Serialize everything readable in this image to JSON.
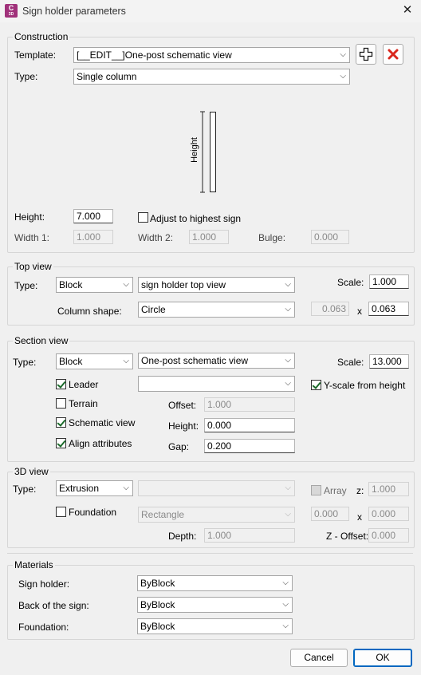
{
  "window": {
    "title": "Sign holder parameters",
    "app_icon_letter": "C",
    "app_icon_sub": "3D"
  },
  "construction": {
    "legend": "Construction",
    "template_label": "Template:",
    "template_value": "[__EDIT__]One-post schematic view",
    "type_label": "Type:",
    "type_value": "Single column",
    "preview_height_label": "Height",
    "height_label": "Height:",
    "height_value": "7.000",
    "adjust_label": "Adjust to highest sign",
    "adjust_checked": false,
    "width1_label": "Width 1:",
    "width1_value": "1.000",
    "width2_label": "Width 2:",
    "width2_value": "1.000",
    "bulge_label": "Bulge:",
    "bulge_value": "0.000"
  },
  "top_view": {
    "legend": "Top view",
    "type_label": "Type:",
    "type_value": "Block",
    "block_value": "sign holder top view",
    "scale_label": "Scale:",
    "scale_value": "1.000",
    "column_shape_label": "Column shape:",
    "column_shape_value": "Circle",
    "dim_x_value": "0.063",
    "x_label": "x",
    "dim_y_value": "0.063"
  },
  "section_view": {
    "legend": "Section view",
    "type_label": "Type:",
    "type_value": "Block",
    "block_value": "One-post schematic view",
    "scale_label": "Scale:",
    "scale_value": "13.000",
    "leader_label": "Leader",
    "leader_checked": true,
    "leader_select_value": "",
    "yscale_label": "Y-scale from height",
    "yscale_checked": true,
    "terrain_label": "Terrain",
    "terrain_checked": false,
    "offset_label": "Offset:",
    "offset_value": "1.000",
    "schematic_label": "Schematic view",
    "schematic_checked": true,
    "height_label": "Height:",
    "height_value": "0.000",
    "align_label": "Align attributes",
    "align_checked": true,
    "gap_label": "Gap:",
    "gap_value": "0.200"
  },
  "view3d": {
    "legend": "3D view",
    "type_label": "Type:",
    "type_value": "Extrusion",
    "second_select_value": "",
    "array_label": "Array",
    "z_label": "z:",
    "z_value": "1.000",
    "foundation_label": "Foundation",
    "foundation_checked": false,
    "foundation_shape_value": "Rectangle",
    "fx_value": "0.000",
    "x_label": "x",
    "fy_value": "0.000",
    "depth_label": "Depth:",
    "depth_value": "1.000",
    "zoffset_label": "Z - Offset:",
    "zoffset_value": "0.000"
  },
  "materials": {
    "legend": "Materials",
    "sign_holder_label": "Sign holder:",
    "sign_holder_value": "ByBlock",
    "back_label": "Back of the sign:",
    "back_value": "ByBlock",
    "foundation_label": "Foundation:",
    "foundation_value": "ByBlock"
  },
  "buttons": {
    "cancel": "Cancel",
    "ok": "OK"
  },
  "colors": {
    "accent": "#0067c0",
    "delete_red": "#d9261c",
    "app_icon": "#a0317a"
  }
}
